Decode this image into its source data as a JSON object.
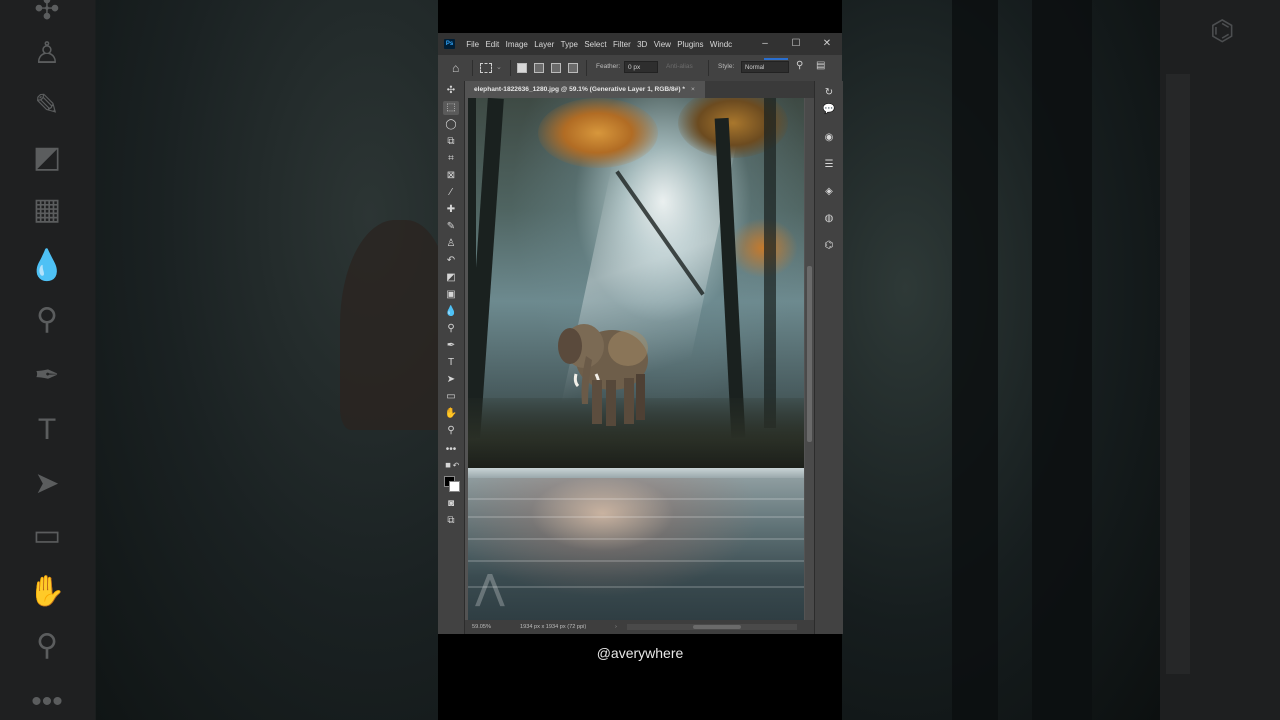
{
  "window": {
    "app_badge": "Ps",
    "menu": [
      "File",
      "Edit",
      "Image",
      "Layer",
      "Type",
      "Select",
      "Filter",
      "3D",
      "View",
      "Plugins",
      "Windc"
    ],
    "controls": {
      "minimize": "–",
      "maximize": "☐",
      "close": "✕"
    }
  },
  "options_bar": {
    "feather_label": "Feather:",
    "feather_value": "0 px",
    "antialias_label": "Anti-alias",
    "style_label": "Style:",
    "style_value": "Normal"
  },
  "document_tab": {
    "title": "elephant-1822636_1280.jpg @ 59.1% (Generative Layer 1, RGB/8#) *",
    "close": "×"
  },
  "status_bar": {
    "zoom": "59.05%",
    "doc_info": "1934 px x 1934 px (72 ppi)",
    "arrow": "›"
  },
  "tools": [
    "move-icon",
    "rectangular-marquee-icon",
    "lasso-icon",
    "object-selection-icon",
    "crop-icon",
    "frame-icon",
    "eyedropper-icon",
    "spot-healing-icon",
    "brush-icon",
    "clone-stamp-icon",
    "history-brush-icon",
    "eraser-icon",
    "gradient-icon",
    "blur-icon",
    "dodge-icon",
    "pen-icon",
    "type-icon",
    "path-selection-icon",
    "rectangle-icon",
    "hand-icon",
    "zoom-icon",
    "more-tools-icon"
  ],
  "right_panel": [
    "history-icon",
    "comments-icon",
    "color-icon",
    "adjustments-icon",
    "layers-icon",
    "channels-icon",
    "paths-icon"
  ],
  "colors": {
    "accent": "#2a6fd0",
    "window_bg": "#535353",
    "panel_bg": "#424242",
    "title_bg": "#323232"
  },
  "handle": "@averywhere"
}
